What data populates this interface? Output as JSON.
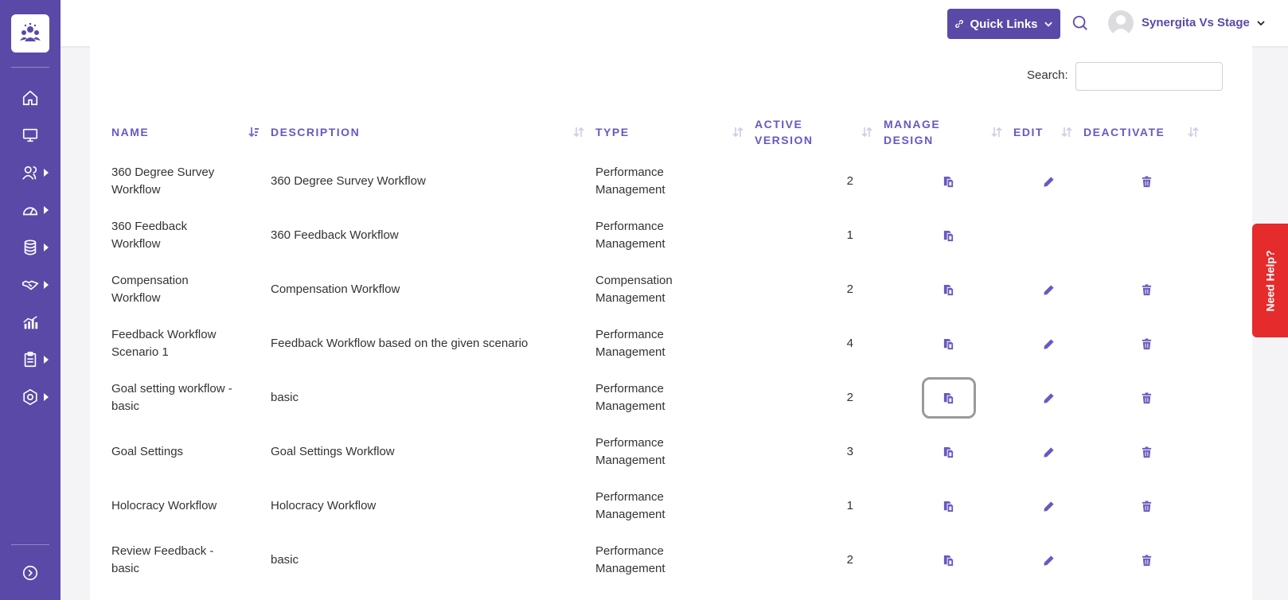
{
  "header": {
    "quick_links_label": "Quick Links",
    "user_name": "Synergita Vs Stage"
  },
  "search": {
    "label": "Search:",
    "value": ""
  },
  "table": {
    "columns": [
      {
        "label": "NAME",
        "label_lines": [
          "NAME"
        ]
      },
      {
        "label": "DESCRIPTION",
        "label_lines": [
          "DESCRIPTION"
        ]
      },
      {
        "label": "TYPE",
        "label_lines": [
          "TYPE"
        ]
      },
      {
        "label": "ACTIVE VERSION",
        "label_lines": [
          "ACTIVE",
          "VERSION"
        ]
      },
      {
        "label": "MANAGE DESIGN",
        "label_lines": [
          "MANAGE",
          "DESIGN"
        ]
      },
      {
        "label": "EDIT",
        "label_lines": [
          "EDIT"
        ]
      },
      {
        "label": "DEACTIVATE",
        "label_lines": [
          "DEACTIVATE"
        ]
      }
    ],
    "rows": [
      {
        "name": [
          "360 Degree Survey",
          "Workflow"
        ],
        "description": "360 Degree Survey Workflow",
        "type": [
          "Performance",
          "Management"
        ],
        "active_version": "2",
        "editable": true,
        "deactivatable": true
      },
      {
        "name": [
          "360 Feedback",
          "Workflow"
        ],
        "description": "360 Feedback Workflow",
        "type": [
          "Performance",
          "Management"
        ],
        "active_version": "1",
        "editable": false,
        "deactivatable": false
      },
      {
        "name": [
          "Compensation",
          "Workflow"
        ],
        "description": "Compensation Workflow",
        "type": [
          "Compensation",
          "Management"
        ],
        "active_version": "2",
        "editable": true,
        "deactivatable": true
      },
      {
        "name": [
          "Feedback Workflow",
          "Scenario 1"
        ],
        "description": "Feedback Workflow based on the given scenario",
        "type": [
          "Performance",
          "Management"
        ],
        "active_version": "4",
        "editable": true,
        "deactivatable": true
      },
      {
        "name": [
          "Goal setting workflow -",
          "basic"
        ],
        "description": "basic",
        "type": [
          "Performance",
          "Management"
        ],
        "active_version": "2",
        "editable": true,
        "deactivatable": true,
        "focused": true
      },
      {
        "name": [
          "Goal Settings"
        ],
        "description": "Goal Settings Workflow",
        "type": [
          "Performance",
          "Management"
        ],
        "active_version": "3",
        "editable": true,
        "deactivatable": true
      },
      {
        "name": [
          "Holocracy Workflow"
        ],
        "description": "Holocracy Workflow",
        "type": [
          "Performance",
          "Management"
        ],
        "active_version": "1",
        "editable": true,
        "deactivatable": true
      },
      {
        "name": [
          "Review Feedback -",
          "basic"
        ],
        "description": "basic",
        "type": [
          "Performance",
          "Management"
        ],
        "active_version": "2",
        "editable": true,
        "deactivatable": true
      }
    ]
  },
  "need_help_label": "Need Help?",
  "colors": {
    "brand": "#5b49a8",
    "accent_text": "#6a58c0",
    "need_help": "#e52b2b"
  },
  "icons": {
    "sidebar": [
      "home-icon",
      "monitor-icon",
      "users-icon",
      "gauge-icon",
      "database-icon",
      "handshake-icon",
      "chart-icon",
      "clipboard-icon",
      "settings-icon",
      "expand-icon"
    ],
    "row_actions": [
      "copy-design-icon",
      "pencil-icon",
      "trash-icon"
    ]
  }
}
